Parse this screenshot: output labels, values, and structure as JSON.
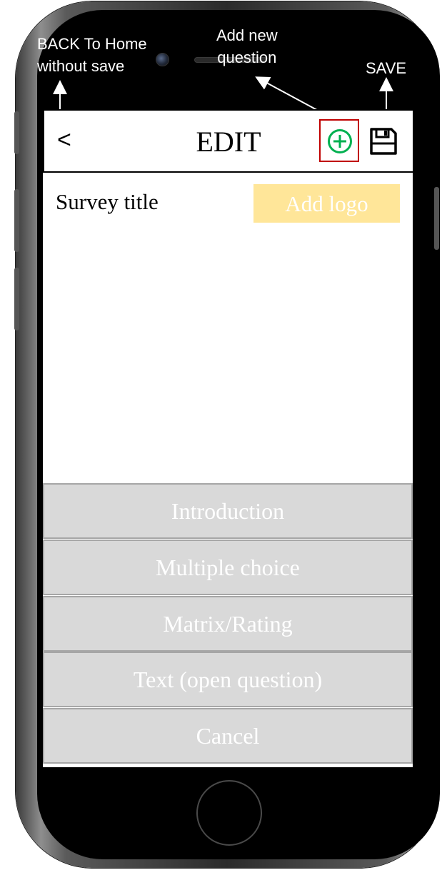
{
  "annotations": {
    "back": "BACK To Home\nwithout save",
    "add_question": "Add new\nquestion",
    "save": "SAVE"
  },
  "header": {
    "back_label": "<",
    "title": "EDIT",
    "add_icon": "plus-circle-icon",
    "save_icon": "floppy-disk-icon"
  },
  "content": {
    "survey_title": "Survey title",
    "add_logo_label": "Add logo"
  },
  "menu": {
    "items": [
      {
        "label": "Introduction"
      },
      {
        "label": "Multiple choice"
      },
      {
        "label": "Matrix/Rating"
      },
      {
        "label": "Text (open question)"
      },
      {
        "label": "Cancel"
      }
    ]
  },
  "colors": {
    "add_icon": "#00b050",
    "add_highlight_border": "#c00000",
    "add_logo_bg": "#ffe699",
    "menu_bg": "#d9d9d9",
    "menu_text": "#ffffff"
  }
}
